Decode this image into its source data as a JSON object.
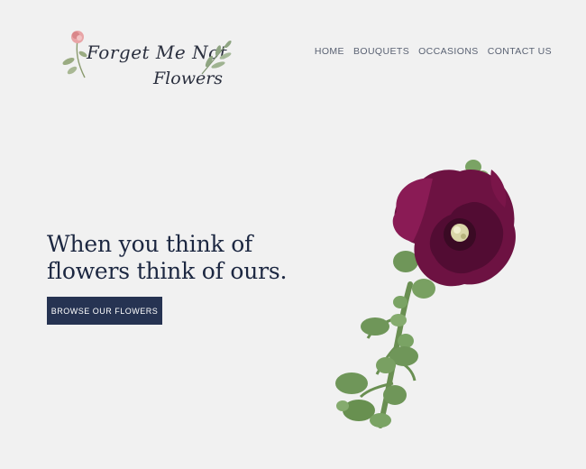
{
  "logo": {
    "line1": "Forget Me Not",
    "line2": "Flowers",
    "icons": [
      "rose-sprig-icon",
      "leaf-sprig-icon"
    ]
  },
  "nav": {
    "items": [
      {
        "label": "HOME"
      },
      {
        "label": "BOUQUETS"
      },
      {
        "label": "OCCASIONS"
      },
      {
        "label": "CONTACT US"
      }
    ]
  },
  "hero": {
    "headline_line1": "When you think of",
    "headline_line2": "flowers think of ours.",
    "cta_label": "BROWSE OUR FLOWERS"
  },
  "colors": {
    "background": "#f1f1f1",
    "text_dark": "#1c2741",
    "button": "#263352",
    "flower_petal": "#6d1242",
    "stem": "#5f8a4a"
  }
}
